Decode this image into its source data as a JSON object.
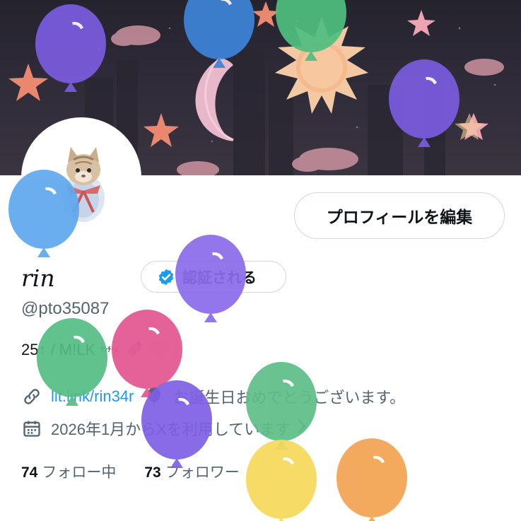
{
  "banner": {
    "icon": "night-sky-banner"
  },
  "avatar": {
    "icon": "cat-plush-avatar"
  },
  "profile": {
    "edit_label": "プロフィールを編集",
    "name": "rin",
    "verify_label": "認証される",
    "handle": "@pto35087",
    "bio_text": "25↑ / M!LK",
    "bio_kana": "ｻﾝﾁｰﾑ",
    "link_text": "lit.link/rin34r",
    "birthday_text": "お誕生日おめでとうございます。",
    "joined_text": "2026年1月からXを利用しています",
    "following_count": "74",
    "following_label": "フォロー中",
    "followers_count": "73",
    "followers_label": "フォロワー"
  },
  "colors": {
    "accent": "#1d9bf0",
    "text": "#0f1419",
    "muted": "#536471",
    "border": "#cfd9de"
  },
  "balloons": [
    {
      "color": "#7b5ce0"
    },
    {
      "color": "#3d84d9"
    },
    {
      "color": "#4fbf7f"
    },
    {
      "color": "#7b5ce0"
    },
    {
      "color": "#5fa8ef"
    },
    {
      "color": "#8a6bea"
    },
    {
      "color": "#55bd84"
    },
    {
      "color": "#e35591"
    },
    {
      "color": "#7d5fe6"
    },
    {
      "color": "#5dbe88"
    },
    {
      "color": "#f6d85a"
    },
    {
      "color": "#f2a350"
    }
  ]
}
